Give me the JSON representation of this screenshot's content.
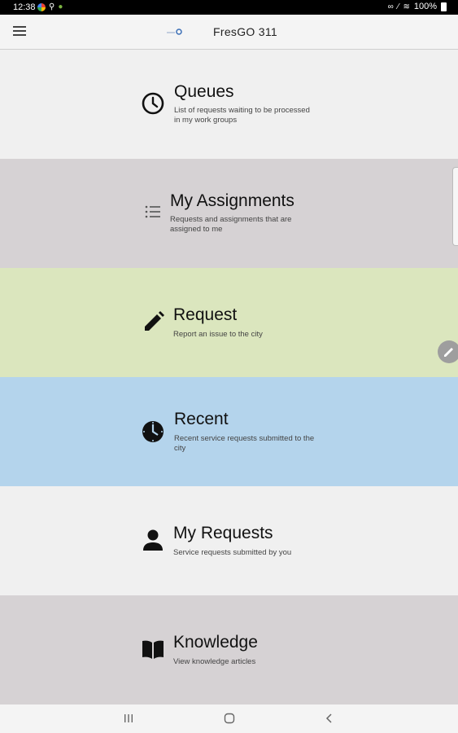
{
  "status_bar": {
    "time": "12:38",
    "battery": "100%",
    "left_icons": [
      "photos-icon",
      "location-icon",
      "android-icon"
    ],
    "right_icons": [
      "link-icon",
      "mute-icon",
      "wifi-icon",
      "battery-icon"
    ]
  },
  "app_bar": {
    "title": "FresGO 311",
    "menu_icon": "hamburger-menu-icon",
    "logo_icon": "app-logo-icon"
  },
  "tiles": [
    {
      "title": "Queues",
      "desc": "List of requests waiting to be processed in my work groups",
      "icon": "clock-icon",
      "bg": "#f0f0f0"
    },
    {
      "title": "My Assignments",
      "desc": "Requests and assignments that are assigned to me",
      "icon": "list-icon",
      "bg": "#d6d2d4"
    },
    {
      "title": "Request",
      "desc": "Report an issue to the city",
      "icon": "pencil-icon",
      "bg": "#dbe6be"
    },
    {
      "title": "Recent",
      "desc": "Recent service requests submitted to the city",
      "icon": "history-icon",
      "bg": "#b4d4ec"
    },
    {
      "title": "My Requests",
      "desc": "Service requests submitted by you",
      "icon": "person-icon",
      "bg": "#f0f0f0"
    },
    {
      "title": "Knowledge",
      "desc": "View knowledge articles",
      "icon": "book-icon",
      "bg": "#d6d2d4"
    }
  ],
  "nav_bar": {
    "buttons": [
      "recent-apps-icon",
      "home-icon",
      "back-icon"
    ]
  }
}
